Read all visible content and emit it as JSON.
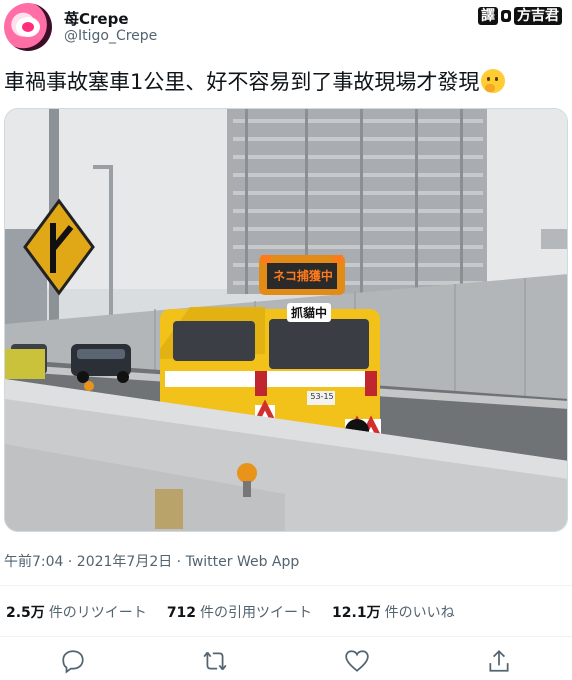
{
  "user": {
    "display_name": "苺Crepe",
    "handle": "@Itigo_Crepe",
    "avatar_icon": "avatar"
  },
  "translator_credit": {
    "badge": "譯",
    "name": "方吉君"
  },
  "tweet": {
    "text": "車禍事故塞車1公里、好不容易到了事故現場才發現",
    "emoji": "thinking-face-icon"
  },
  "photo": {
    "sign_text": "ネコ捕獲中",
    "caption": "抓貓中",
    "plate": "53-15"
  },
  "timestamp": "午前7:04 · 2021年7月2日 · Twitter Web App",
  "stats": [
    {
      "value": "2.5万",
      "label": "件のリツイート"
    },
    {
      "value": "712",
      "label": "件の引用ツイート"
    },
    {
      "value": "12.1万",
      "label": "件のいいね"
    }
  ],
  "actions": [
    "reply-icon",
    "retweet-icon",
    "like-icon",
    "share-icon"
  ],
  "colors": {
    "handle": "#536471",
    "truck": "#f2c21b",
    "sign": "#e38b17"
  }
}
